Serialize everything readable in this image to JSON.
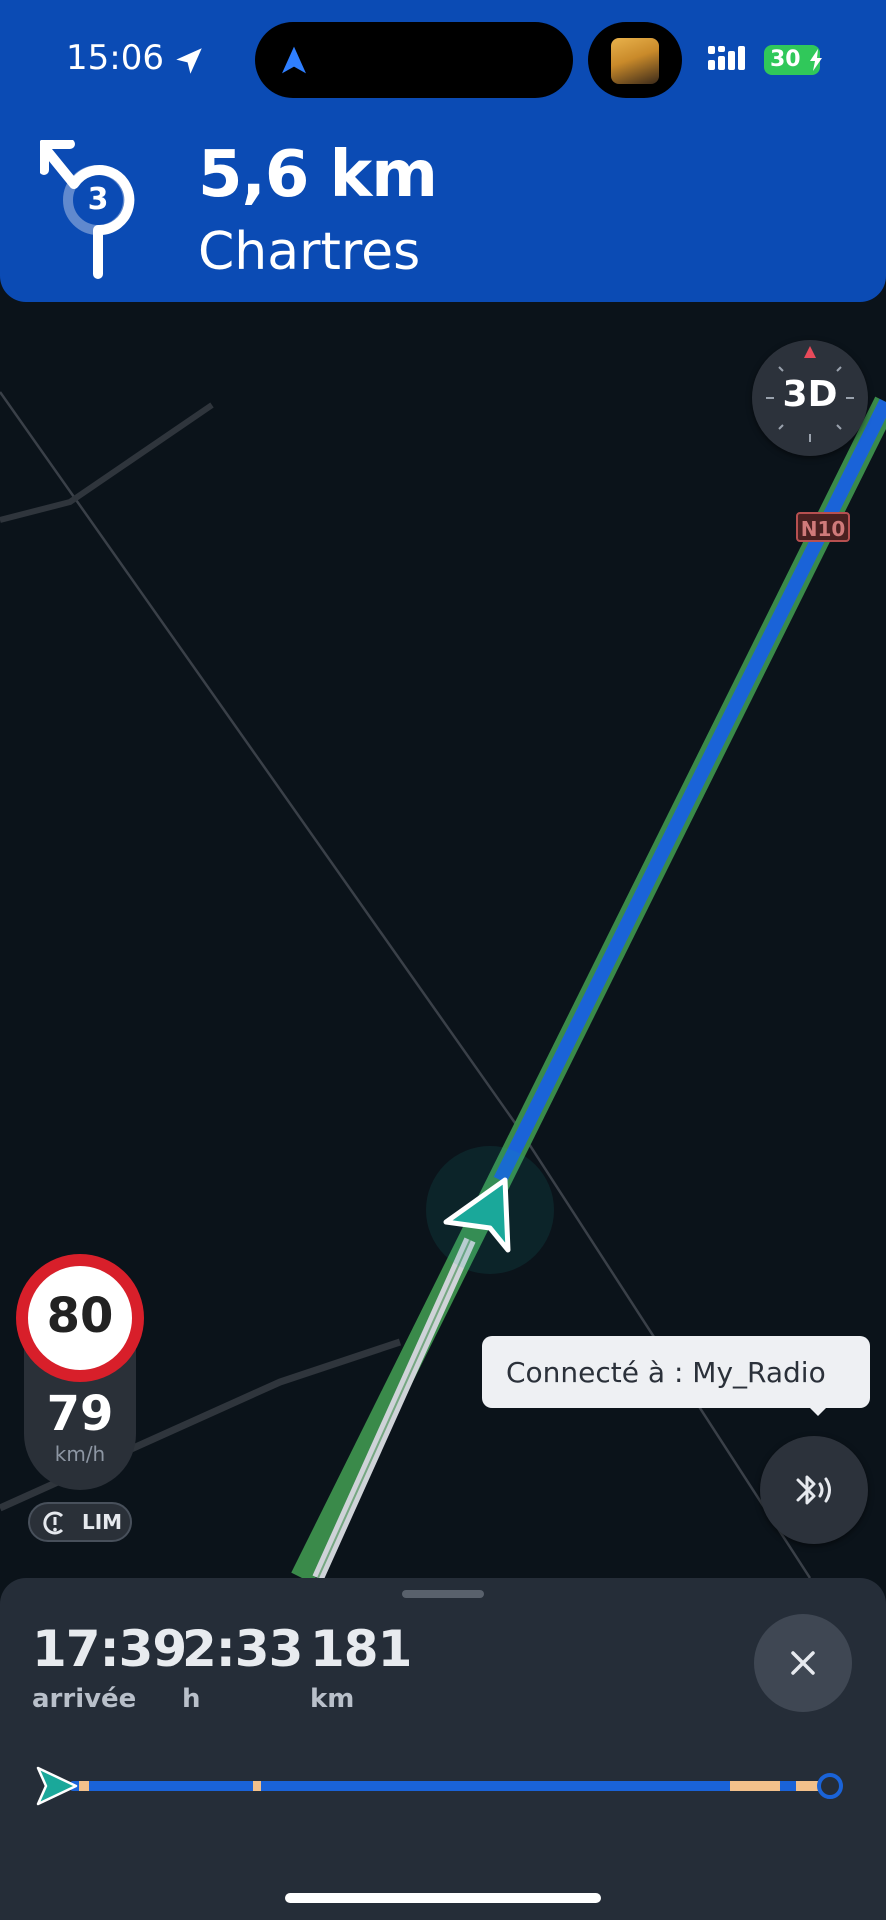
{
  "status_bar": {
    "time": "15:06",
    "battery": "30",
    "icons": [
      "location-arrow-icon",
      "navigation-icon",
      "album-art",
      "signal-icon",
      "battery-charging-icon"
    ]
  },
  "maneuver": {
    "type": "roundabout",
    "exit_number": "3",
    "distance": "5,6 km",
    "street": "Chartres"
  },
  "map": {
    "view_mode": "3D",
    "road_shield": "N10",
    "route_color": "#1a63d8",
    "route_outline_color": "#3a8a4a"
  },
  "speed": {
    "limit": "80",
    "current": "79",
    "unit": "km/h",
    "lim_label": "LIM"
  },
  "toast": {
    "text": "Connecté à : My_Radio"
  },
  "trip": {
    "arrival_time": "17:39",
    "arrival_label": "arrivée",
    "duration": "2:33",
    "duration_label": "h",
    "distance": "181",
    "distance_label": "km"
  },
  "colors": {
    "banner": "#0b4bb4",
    "panel": "#252d38",
    "map_bg": "#0b131a",
    "vehicle": "#1aa89a",
    "traffic_slow": "#f2c08b"
  }
}
